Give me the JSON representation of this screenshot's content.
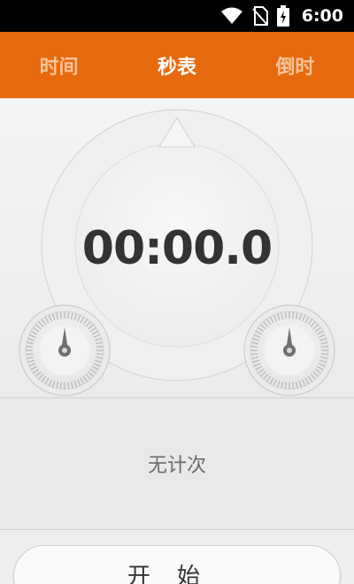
{
  "status": {
    "time": "6:00",
    "icons": [
      "wifi-icon",
      "no-sim-icon",
      "battery-icon"
    ]
  },
  "tabs": [
    {
      "label": "时间",
      "active": false
    },
    {
      "label": "秒表",
      "active": true
    },
    {
      "label": "倒时",
      "active": false
    }
  ],
  "stopwatch": {
    "display": "00:00.0"
  },
  "laps": {
    "empty_text": "无计次"
  },
  "controls": {
    "start_label": "开始"
  },
  "colors": {
    "accent": "#e86a0e",
    "tab_inactive": "#f6c49c",
    "text_dark": "#333333"
  }
}
